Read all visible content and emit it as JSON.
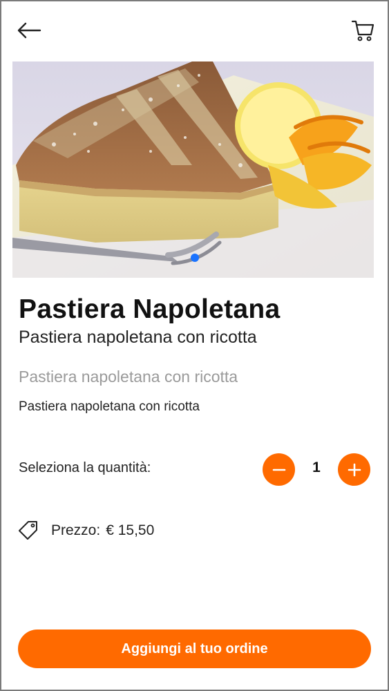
{
  "header": {
    "back_icon": "arrow-left-icon",
    "cart_icon": "shopping-cart-icon"
  },
  "gallery": {
    "image_description": "slice of pastiera cake with fork and orange/lemon peel",
    "dots_count": 1,
    "active_dot_color": "#1a73ff"
  },
  "product": {
    "title": "Pastiera Napoletana",
    "subtitle": "Pastiera napoletana con ricotta",
    "description_muted": "Pastiera napoletana con ricotta",
    "description": "Pastiera napoletana con ricotta"
  },
  "quantity": {
    "label": "Seleziona la quantità:",
    "value": "1",
    "minus_icon": "minus-icon",
    "plus_icon": "plus-icon"
  },
  "price": {
    "label": "Prezzo:",
    "amount": "€ 15,50",
    "icon": "tag-icon"
  },
  "cta": {
    "label": "Aggiungi al tuo ordine"
  },
  "colors": {
    "accent": "#ff6a00",
    "muted_text": "#9a9a9a"
  }
}
